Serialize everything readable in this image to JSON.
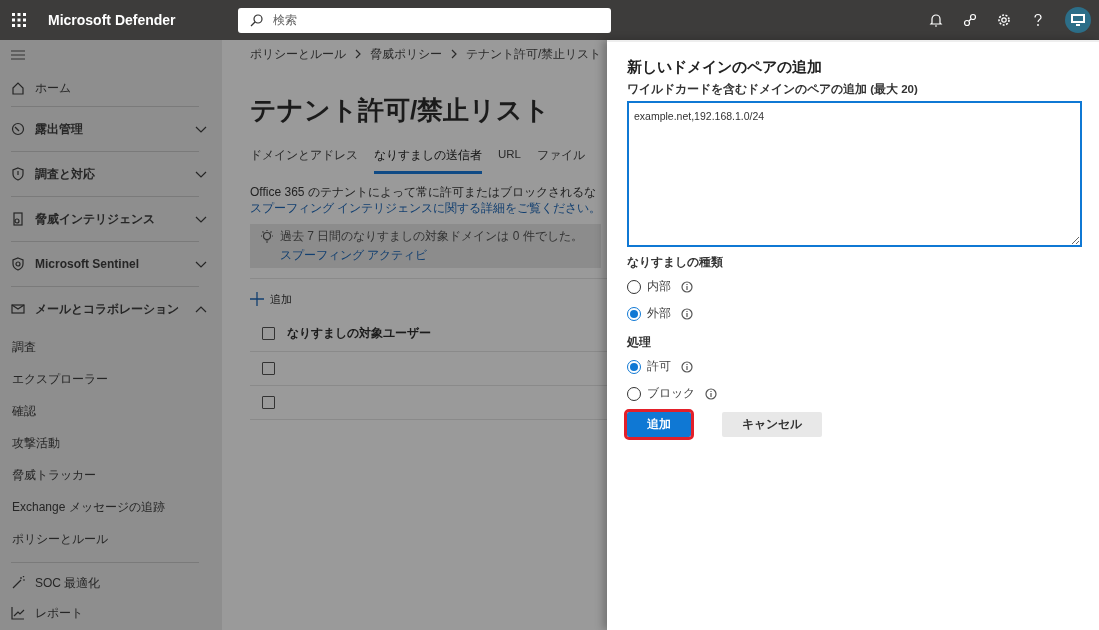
{
  "header": {
    "app_title": "Microsoft Defender",
    "search": {
      "placeholder": "検索"
    }
  },
  "sidebar": {
    "items": [
      {
        "kind": "link",
        "label": "ホーム"
      },
      {
        "kind": "group",
        "label": "露出管理",
        "expanded": false
      },
      {
        "kind": "group",
        "label": "調査と対応",
        "expanded": false
      },
      {
        "kind": "group",
        "label": "脅威インテリジェンス",
        "expanded": false
      },
      {
        "kind": "group",
        "label": "Microsoft Sentinel",
        "expanded": false
      },
      {
        "kind": "group",
        "label": "メールとコラボレーション",
        "expanded": true,
        "children": [
          "調査",
          "エクスプローラー",
          "確認",
          "攻撃活動",
          "脅威トラッカー",
          "Exchange メッセージの追跡",
          "ポリシーとルール"
        ]
      },
      {
        "kind": "link",
        "label": "SOC 最適化"
      },
      {
        "kind": "link",
        "label": "レポート"
      }
    ]
  },
  "main": {
    "breadcrumb": [
      "ポリシーとルール",
      "脅威ポリシー",
      "テナント許可/禁止リスト"
    ],
    "title": "テナント許可/禁止リスト",
    "tabs": [
      {
        "label": "ドメインとアドレス",
        "selected": false
      },
      {
        "label": "なりすましの送信者",
        "selected": true
      },
      {
        "label": "URL",
        "selected": false
      },
      {
        "label": "ファイル",
        "selected": false
      }
    ],
    "description": "Office 365 のテナントによって常に許可またはブロックされるな",
    "description_link": "スプーフィング インテリジェンスに関する詳細をご覧ください。",
    "info_bar": {
      "text": "過去 7 日間のなりすましの対象ドメインは 0 件でした。",
      "link": "スプーフィング アクティビ"
    },
    "add_button": "追加",
    "table": {
      "columns": [
        "なりすましの対象ユーザー"
      ],
      "header_checked": false,
      "rows": [
        {
          "checked": false
        },
        {
          "checked": false
        }
      ]
    }
  },
  "panel": {
    "title": "新しいドメインのペアの追加",
    "field": {
      "label": "ワイルドカードを含むドメインのペアの追加 (最大 20)",
      "value": "example.net,192.168.1.0/24"
    },
    "groups": [
      {
        "label": "なりすましの種類",
        "options": [
          {
            "label": "内部",
            "selected": false
          },
          {
            "label": "外部",
            "selected": true
          }
        ]
      },
      {
        "label": "処理",
        "options": [
          {
            "label": "許可",
            "selected": true
          },
          {
            "label": "ブロック",
            "selected": false
          }
        ]
      }
    ],
    "buttons": [
      {
        "kind": "primary",
        "label": "追加",
        "highlighted": true
      },
      {
        "kind": "secondary",
        "label": "キャンセル",
        "highlighted": false
      }
    ]
  }
}
